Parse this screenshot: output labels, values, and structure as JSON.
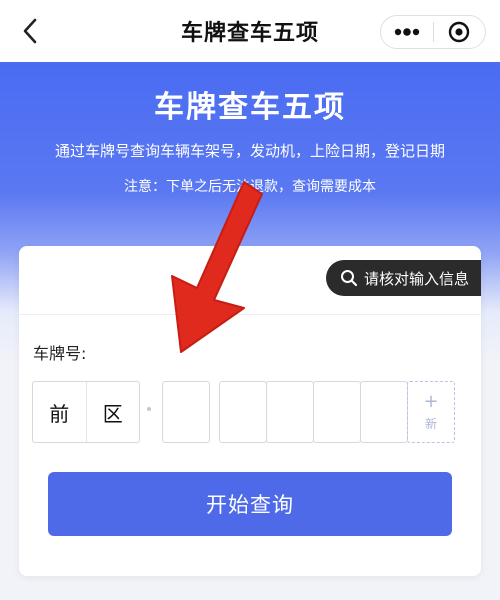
{
  "nav": {
    "title": "车牌查车五项",
    "back_icon": "chevron-left-icon",
    "more_icon": "more-dots-icon",
    "close_icon": "target-close-icon"
  },
  "hero": {
    "title": "车牌查车五项",
    "description": "通过车牌号查询车辆车架号，发动机，上险日期，登记日期",
    "notice": "注意：下单之后无法退款，查询需要成本"
  },
  "form": {
    "verify_tip": "请核对输入信息",
    "plate_label": "车牌号:",
    "province": "前",
    "region": "区",
    "plate_chars": [
      "",
      "",
      "",
      "",
      ""
    ],
    "new_energy_plus": "+",
    "new_energy_label": "新",
    "submit_label": "开始查询"
  },
  "colors": {
    "brand": "#4e6ae8",
    "annotation_arrow": "#e02a1d"
  }
}
